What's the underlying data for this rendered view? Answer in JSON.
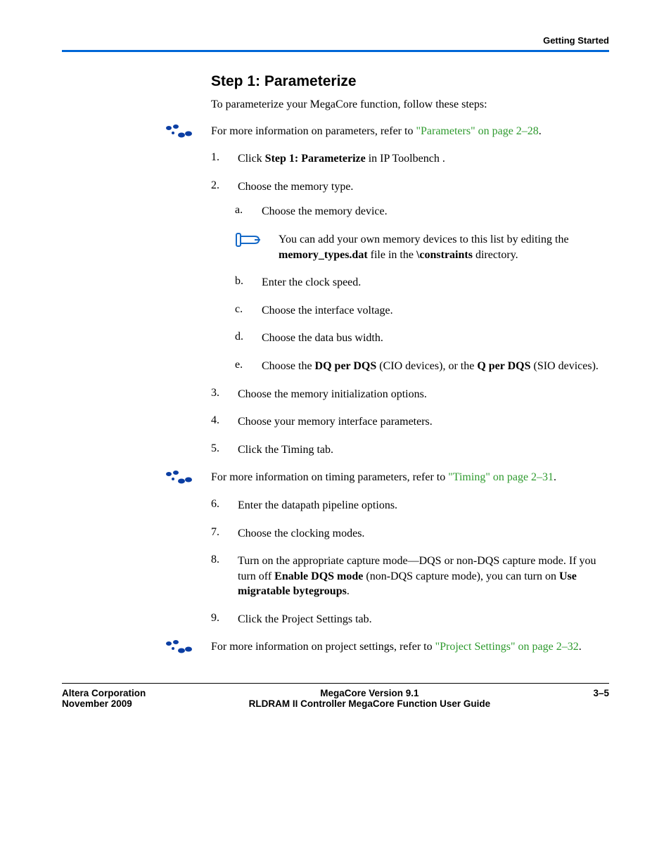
{
  "running_head": "Getting Started",
  "section_title": "Step 1: Parameterize",
  "intro": "To parameterize your MegaCore function, follow these steps:",
  "note1_prefix": "For more information on parameters, refer to ",
  "note1_link": "\"Parameters\" on page 2–28",
  "steps": {
    "s1_pre": "Click ",
    "s1_bold": "Step 1: Parameterize",
    "s1_post": " in IP Toolbench .",
    "s2": "Choose the memory type.",
    "s2a": "Choose the memory device.",
    "s2_note_pre": "You can add your own memory devices to this list by editing the ",
    "s2_note_b1": "memory_types.dat",
    "s2_note_mid": " file in the ",
    "s2_note_b2": "\\constraints",
    "s2_note_post": " directory.",
    "s2b": "Enter the clock speed.",
    "s2c": "Choose the interface voltage.",
    "s2d": "Choose the data bus width.",
    "s2e_pre": "Choose the ",
    "s2e_b1": "DQ per DQS",
    "s2e_mid": " (CIO devices), or the ",
    "s2e_b2": "Q per DQS",
    "s2e_post": " (SIO devices).",
    "s3": "Choose the memory initialization options.",
    "s4": "Choose your memory interface parameters.",
    "s5": "Click the Timing tab."
  },
  "note2_prefix": "For more information on timing parameters, refer to ",
  "note2_link": "\"Timing\" on page 2–31",
  "steps2": {
    "s6": "Enter the datapath pipeline options.",
    "s7": "Choose the clocking modes.",
    "s8_pre": "Turn on the appropriate capture mode—DQS or non-DQS capture mode. If you turn off ",
    "s8_b1": "Enable DQS mode",
    "s8_mid": " (non-DQS capture mode), you can turn on ",
    "s8_b2": "Use migratable bytegroups",
    "s8_post": ".",
    "s9": "Click the Project Settings tab."
  },
  "note3_prefix": "For more information on project settings, refer to ",
  "note3_link": "\"Project Settings\" on page 2–32",
  "footer": {
    "left1": "Altera Corporation",
    "left2": "November 2009",
    "center1": "MegaCore Version 9.1",
    "center2": "RLDRAM II Controller MegaCore Function User Guide",
    "right": "3–5"
  }
}
